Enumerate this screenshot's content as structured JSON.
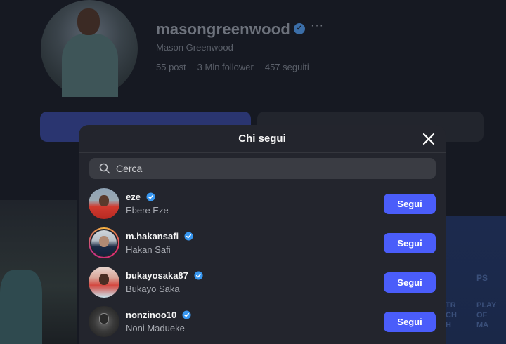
{
  "profile": {
    "username": "masongreenwood",
    "full_name": "Mason Greenwood",
    "posts": "55 post",
    "followers": "3 Mln follower",
    "following": "457 seguiti",
    "more_glyph": "···"
  },
  "modal": {
    "title": "Chi segui",
    "search_placeholder": "Cerca",
    "follow_label": "Segui",
    "accounts": [
      {
        "username": "eze",
        "full_name": "Ebere Eze",
        "verified": true
      },
      {
        "username": "m.hakansafi",
        "full_name": "Hakan Safi",
        "verified": true
      },
      {
        "username": "bukayosaka87",
        "full_name": "Bukayo Saka",
        "verified": true
      },
      {
        "username": "nonzinoo10",
        "full_name": "Noni Madueke",
        "verified": true
      }
    ]
  },
  "background_text": {
    "right_tile_lines": "TR\nCH\nH",
    "right_tile_lines_2": "PLAY\nOF\nMA",
    "ps_logo": "PS"
  },
  "colors": {
    "accent_button": "#4a5dfa",
    "verified_badge": "#3897f0",
    "modal_bg": "#23252d",
    "page_bg": "#161922"
  }
}
